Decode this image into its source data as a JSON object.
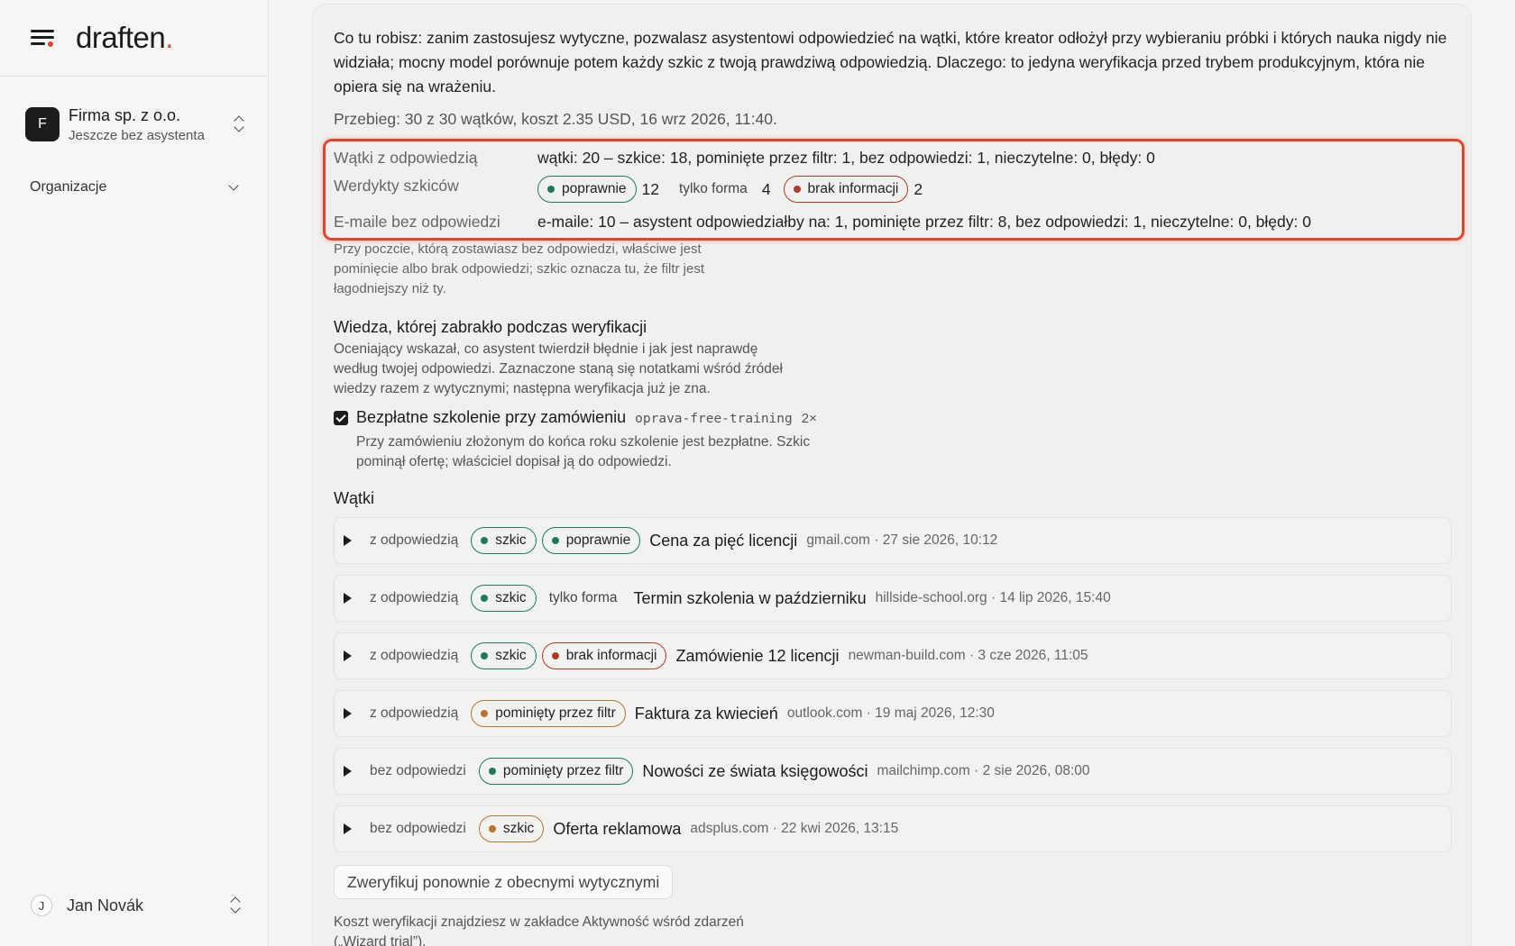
{
  "sidebar": {
    "logo_text": "draften",
    "logo_dot": ".",
    "org": {
      "initial": "F",
      "name": "Firma sp. z o.o.",
      "subtitle": "Jeszcze bez asystenta"
    },
    "nav_label": "Organizacje",
    "user": {
      "initial": "J",
      "name": "Jan Novák"
    }
  },
  "main": {
    "intro": "Co tu robisz: zanim zastosujesz wytyczne, pozwalasz asystentowi odpowiedzieć na wątki, które kreator odłożył przy wybieraniu próbki i których nauka nigdy nie widziała; mocny model porównuje potem każdy szkic z twoją prawdziwą odpowiedzią. Dlaczego: to jedyna weryfikacja przed trybem produkcyjnym, która nie opiera się na wrażeniu.",
    "run_info": "Przebieg: 30 z 30 wątków, koszt 2.35 USD, 16 wrz 2026, 11:40.",
    "summary": {
      "threads_label": "Wątki z odpowiedzią",
      "threads_value": "wątki: 20 – szkice: 18, pominięte przez filtr: 1, bez odpowiedzi: 1, nieczytelne: 0, błędy: 0",
      "verdicts_label": "Werdykty szkiców",
      "verdict_correct_label": "poprawnie",
      "verdict_correct_count": "12",
      "verdict_form_label": "tylko forma",
      "verdict_form_count": "4",
      "verdict_missing_label": "brak informacji",
      "verdict_missing_count": "2",
      "emails_label": "E-maile bez odpowiedzi",
      "emails_value": "e-maile: 10 – asystent odpowiedziałby na: 1, pominięte przez filtr: 8, bez odpowiedzi: 1, nieczytelne: 0, błędy: 0"
    },
    "note": "Przy poczcie, którą zostawiasz bez odpowiedzi, właściwe jest pominięcie albo brak odpowiedzi; szkic oznacza tu, że filtr jest łagodniejszy niż ty.",
    "knowledge": {
      "title": "Wiedza, której zabrakło podczas weryfikacji",
      "description": "Oceniający wskazał, co asystent twierdził błędnie i jak jest naprawdę według twojej odpowiedzi. Zaznaczone staną się notatkami wśród źródeł wiedzy razem z wytycznymi; następna weryfikacja już je zna.",
      "item": {
        "checked": true,
        "title": "Bezpłatne szkolenie przy zamówieniu",
        "code": "oprava-free-training",
        "count": "2×",
        "description": "Przy zamówieniu złożonym do końca roku szkolenie jest bezpłatne. Szkic pominął ofertę; właściciel dopisał ją do odpowiedzi."
      }
    },
    "threads_title": "Wątki",
    "threads": [
      {
        "status": "z odpowiedzią",
        "subject": "Cena za pięć licencji",
        "meta": "gmail.com · 27 sie 2026, 10:12"
      },
      {
        "status": "z odpowiedzią",
        "subject": "Termin szkolenia w październiku",
        "meta": "hillside-school.org · 14 lip 2026, 15:40"
      },
      {
        "status": "z odpowiedzią",
        "subject": "Zamówienie 12 licencji",
        "meta": "newman-build.com · 3 cze 2026, 11:05"
      },
      {
        "status": "z odpowiedzią",
        "subject": "Faktura za kwiecień",
        "meta": "outlook.com · 19 maj 2026, 12:30"
      },
      {
        "status": "bez odpowiedzi",
        "subject": "Nowości ze świata księgowości",
        "meta": "mailchimp.com · 2 sie 2026, 08:00"
      },
      {
        "status": "bez odpowiedzi",
        "subject": "Oferta reklamowa",
        "meta": "adsplus.com · 22 kwi 2026, 13:15"
      }
    ],
    "tags": {
      "draft": "szkic",
      "correct": "poprawnie",
      "form_only": "tylko forma",
      "missing_info": "brak informacji",
      "filtered": "pominięty przez filtr"
    },
    "reverify_button": "Zweryfikuj ponownie z obecnymi wytycznymi",
    "footer_note": "Koszt weryfikacji znajdziesz w zakładce Aktywność wśród zdarzeń („Wizard trial”).",
    "colors": {
      "accent": "#e0452f",
      "green": "#1d7a5f",
      "red": "#b23a2c",
      "orange": "#b8742a"
    }
  }
}
